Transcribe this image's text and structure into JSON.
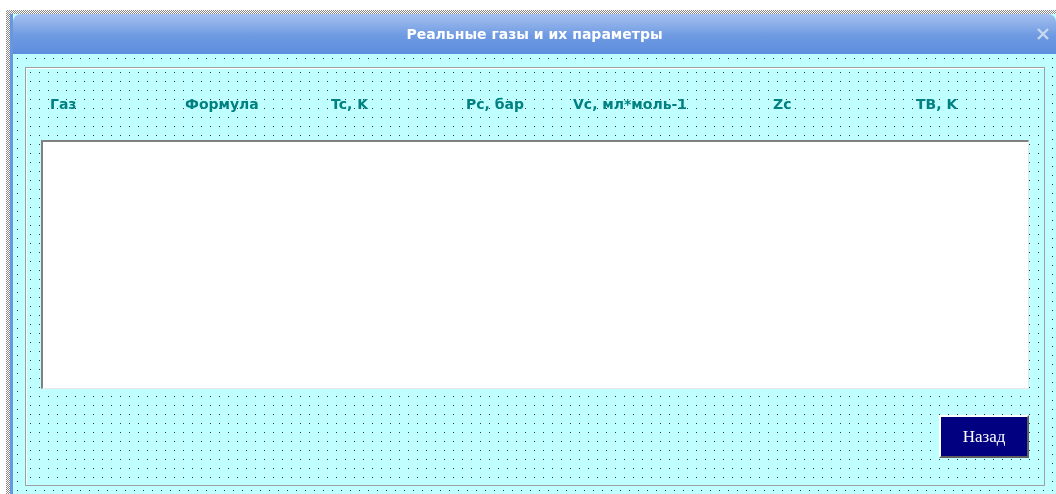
{
  "window": {
    "title": "Реальные газы и их параметры"
  },
  "columns": [
    {
      "label": "Газ"
    },
    {
      "label": "Формула"
    },
    {
      "label": "Tc, K"
    },
    {
      "label": "Pc, бар"
    },
    {
      "label": "Vc, мл*моль-1"
    },
    {
      "label": "Zc"
    },
    {
      "label": "TB, K"
    }
  ],
  "buttons": [
    {
      "label": "Назад"
    }
  ]
}
